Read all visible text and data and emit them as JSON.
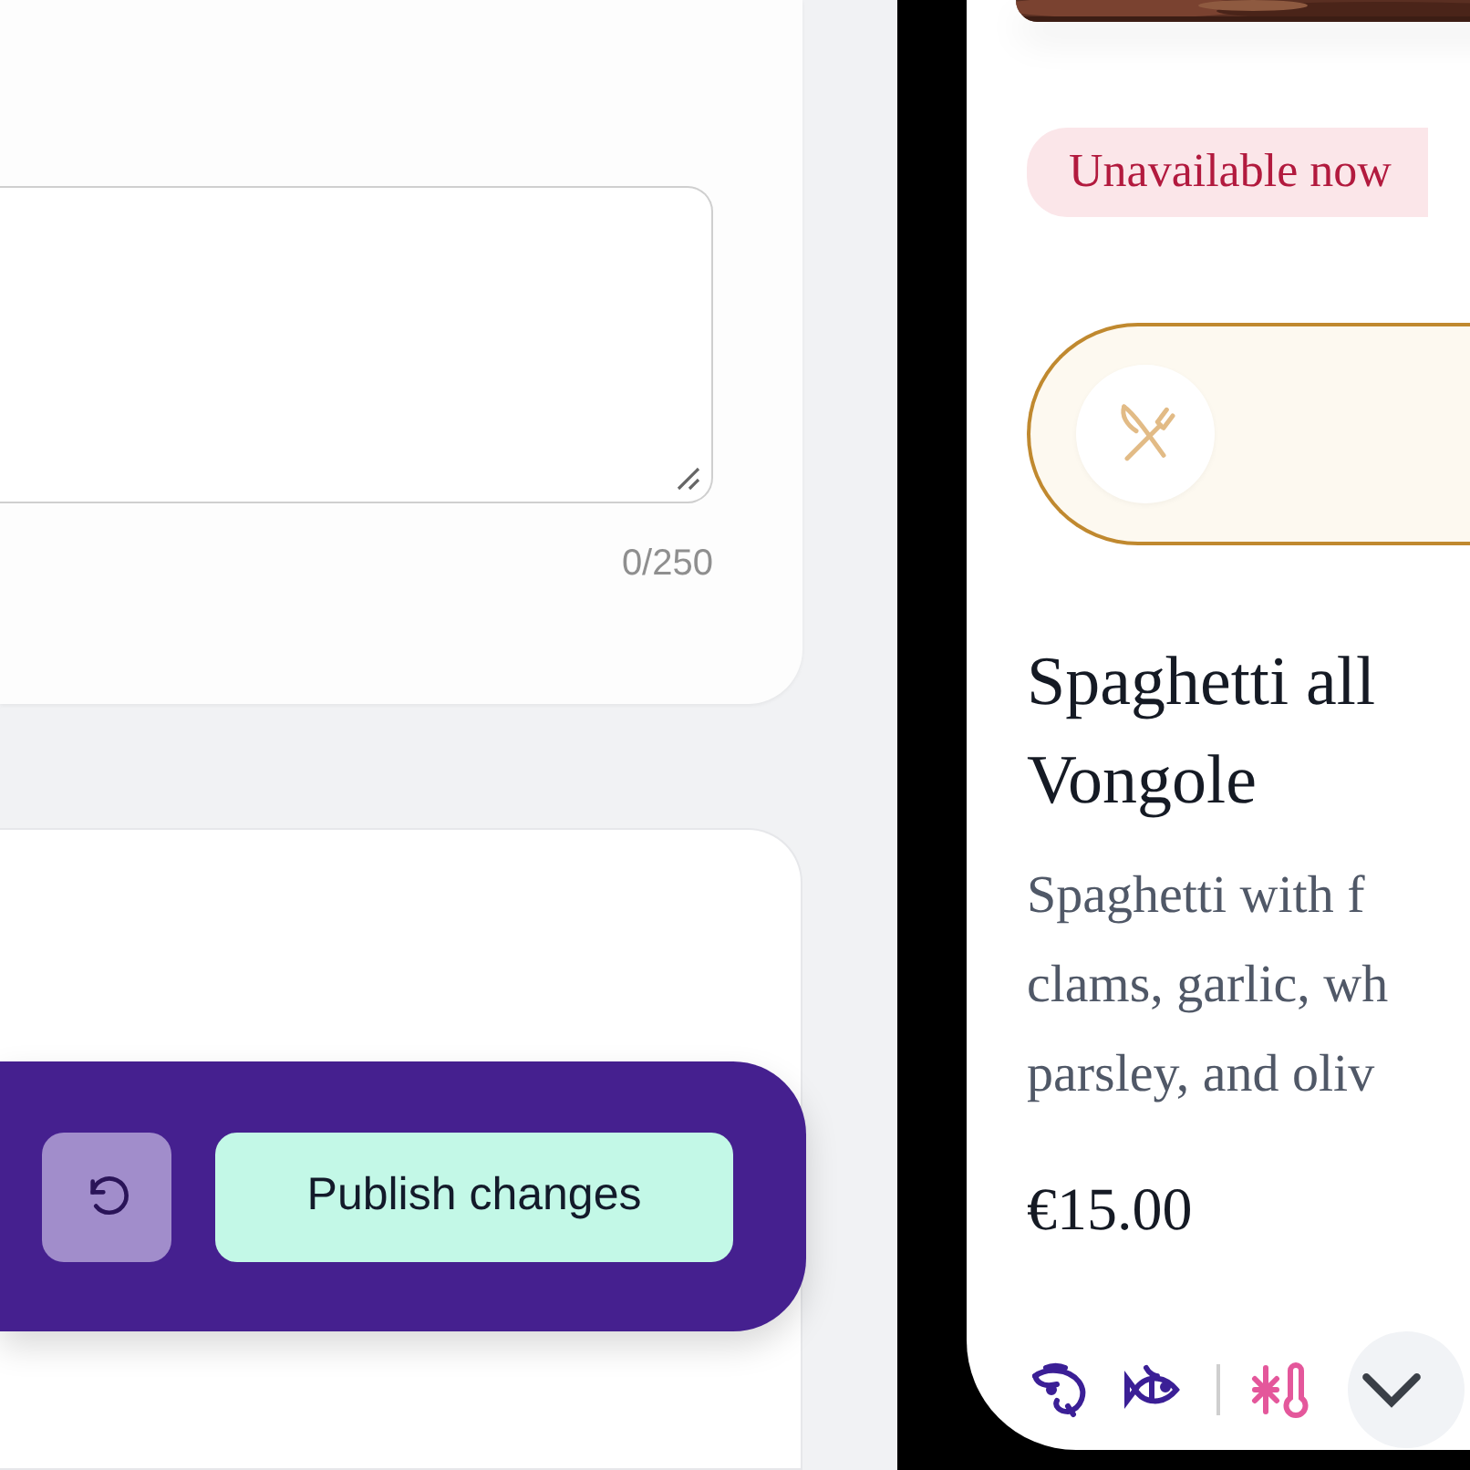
{
  "editor": {
    "description_counter": "0/250"
  },
  "action_bar": {
    "publish_button": "Publish changes"
  },
  "preview": {
    "status_badge": "Unavailable now",
    "title_lines": [
      "Spaghetti all",
      "Vongole"
    ],
    "description_lines": [
      "Spaghetti with f",
      "clams, garlic, wh",
      "parsley, and oliv"
    ],
    "price": "€15.00",
    "allergens": [
      {
        "kind": "shrimp",
        "color": "#3b1f96"
      },
      {
        "kind": "fish",
        "color": "#3b1f96"
      }
    ],
    "storage": [
      {
        "kind": "frozen",
        "color": "#e4579b"
      }
    ]
  }
}
